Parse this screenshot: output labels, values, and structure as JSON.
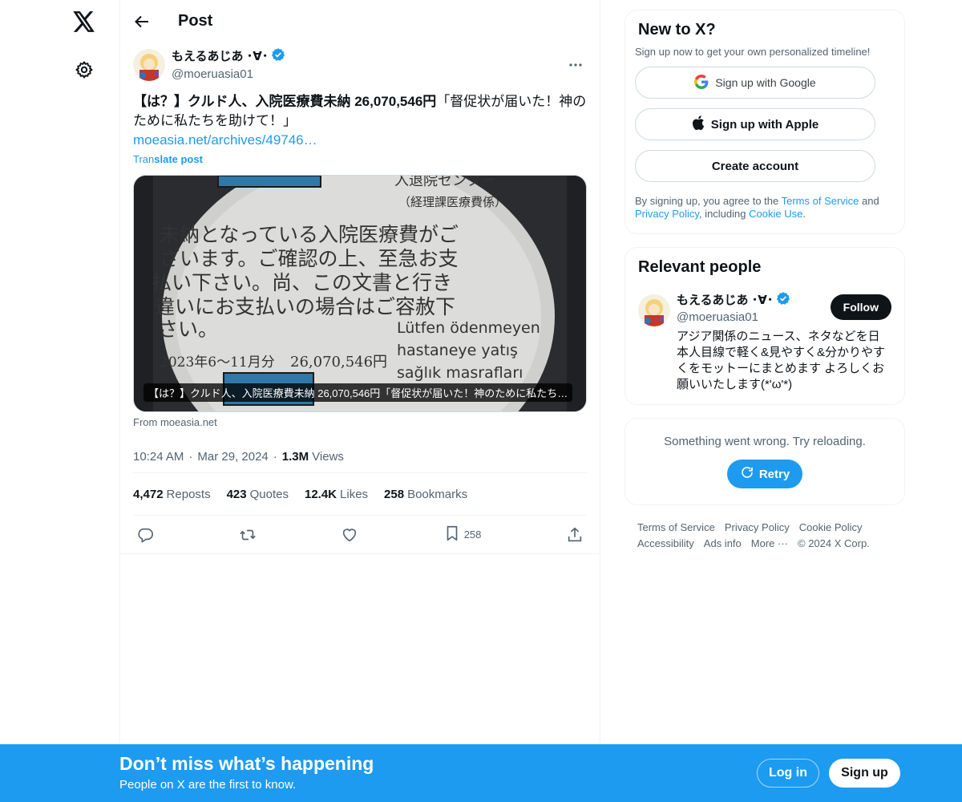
{
  "header": {
    "title": "Post"
  },
  "nav": {
    "logo_icon": "x-logo-icon",
    "settings_icon": "gear-icon"
  },
  "post": {
    "author_name": "もえるあじあ ･∀･",
    "handle": "@moeruasia01",
    "text_bold": "【は？】クルド人、入院医療費未納 26,070,546円",
    "text_rest": "「督促状が届いた！神のために私たちを助けて！」",
    "link": "moeasia.net/archives/49746…",
    "translate_prefix": "Tran",
    "translate_bold": "slate post",
    "media": {
      "caption": "【は？】クルド人、入院医療費未納 26,070,546円「督促状が届いた！神のために私たち…",
      "doc_header": "入退院センター",
      "doc_header_sub": "（経理課医療費係）",
      "doc_lines": [
        "未納となっている入院医療費がご",
        "ざいます。ご確認の上、至急お支",
        "払い下さい。尚、この文書と行き",
        "違いにお支払いの場合はご容赦下",
        "さい。"
      ],
      "doc_amount_period": "2023年6〜11月分",
      "doc_amount": "26,070,546円",
      "doc_turkish": [
        "Lütfen ödenmeyen",
        "hastaneye yatış",
        "sağlık masrafları"
      ]
    },
    "from": "From moeasia.net",
    "time": "10:24 AM",
    "date": "Mar 29, 2024",
    "views_count": "1.3M",
    "views_label": "Views",
    "stats": [
      {
        "count": "4,472",
        "label": "Reposts"
      },
      {
        "count": "423",
        "label": "Quotes"
      },
      {
        "count": "12.4K",
        "label": "Likes"
      },
      {
        "count": "258",
        "label": "Bookmarks"
      }
    ],
    "actions": {
      "bookmark_count": "258"
    }
  },
  "sidebar": {
    "new_to_x": {
      "title": "New to X?",
      "subtitle": "Sign up now to get your own personalized timeline!",
      "google_label": "Sign up with Google",
      "apple_label": "Sign up with Apple",
      "create_label": "Create account",
      "legal_1": "By signing up, you agree to the ",
      "tos": "Terms of Service",
      "legal_2": " and ",
      "privacy": "Privacy Policy",
      "legal_3": ", including ",
      "cookie": "Cookie Use",
      "legal_4": "."
    },
    "relevant": {
      "title": "Relevant people",
      "name": "もえるあじあ ･∀･",
      "handle": "@moeruasia01",
      "follow_label": "Follow",
      "bio": "アジア関係のニュース、ネタなどを日本人目線で軽く&見やすく&分かりやすくをモットーにまとめます よろしくお願いいたします(*'ω'*)"
    },
    "error": {
      "text": "Something went wrong. Try reloading.",
      "retry_label": "Retry"
    },
    "footer": {
      "terms": "Terms of Service",
      "privacy": "Privacy Policy",
      "cookie": "Cookie Policy",
      "accessibility": "Accessibility",
      "ads": "Ads info",
      "more": "More ···",
      "copyright": "© 2024 X Corp."
    }
  },
  "banner": {
    "title": "Don’t miss what’s happening",
    "subtitle": "People on X are the first to know.",
    "login_label": "Log in",
    "signup_label": "Sign up"
  },
  "colors": {
    "accent": "#1d9bf0",
    "text": "#0f1419",
    "muted": "#536471",
    "border": "#eff3f4"
  }
}
